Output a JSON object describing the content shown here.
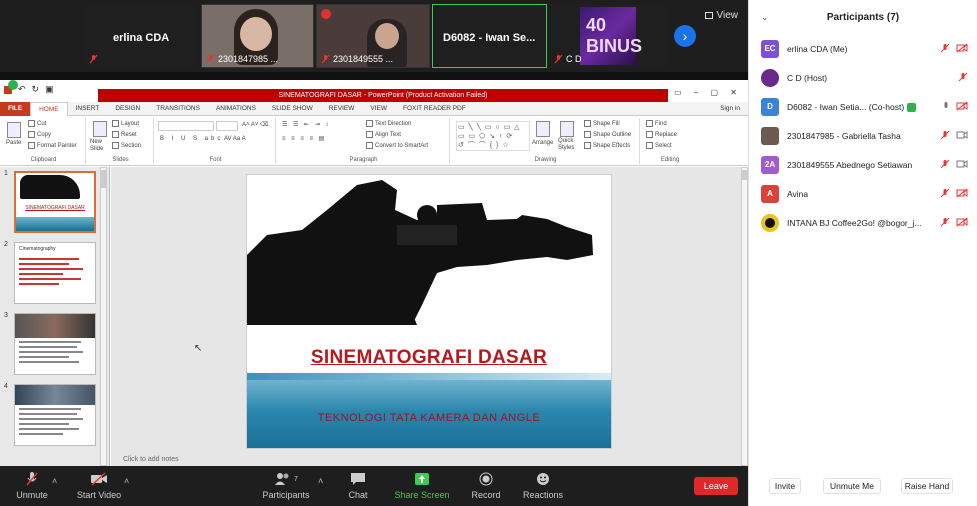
{
  "video_strip": {
    "tiles": [
      {
        "name": "erlina CDA"
      },
      {
        "label": "2301847985 ..."
      },
      {
        "label": "2301849555 ..."
      },
      {
        "name": "D6082 - Iwan Se..."
      },
      {
        "label": "C D"
      }
    ],
    "view_label": "View",
    "logo_text": "40 BINUS"
  },
  "powerpoint": {
    "title_bar": "SINEMATOGRAFI DASAR - PowerPoint (Product Activation Failed)",
    "sign_in": "Sign in",
    "tabs": [
      "FILE",
      "HOME",
      "INSERT",
      "DESIGN",
      "TRANSITIONS",
      "ANIMATIONS",
      "SLIDE SHOW",
      "REVIEW",
      "VIEW",
      "FOXIT READER PDF"
    ],
    "groups": {
      "clipboard": {
        "label": "Clipboard",
        "paste": "Paste",
        "cut": "Cut",
        "copy": "Copy",
        "format_painter": "Format Painter"
      },
      "slides": {
        "label": "Slides",
        "new_slide": "New Slide",
        "layout": "Layout",
        "reset": "Reset",
        "section": "Section"
      },
      "font": {
        "label": "Font"
      },
      "paragraph": {
        "label": "Paragraph",
        "text_direction": "Text Direction",
        "align_text": "Align Text",
        "convert": "Convert to SmartArt"
      },
      "drawing": {
        "label": "Drawing",
        "arrange": "Arrange",
        "quick_styles": "Quick Styles",
        "shape_fill": "Shape Fill",
        "shape_outline": "Shape Outline",
        "shape_effects": "Shape Effects"
      },
      "editing": {
        "label": "Editing",
        "find": "Find",
        "replace": "Replace",
        "select": "Select"
      }
    },
    "slide_numbers": [
      "1",
      "2",
      "3",
      "4"
    ],
    "thumb2_title": "Cinematography",
    "thumb1_title": "SINEMATOGRAFI DASAR",
    "slide": {
      "title": "SINEMATOGRAFI DASAR",
      "subtitle": "TEKNOLOGI TATA KAMERA DAN ANGLE"
    },
    "notes_placeholder": "Click to add notes"
  },
  "toolbar": {
    "unmute": "Unmute",
    "start_video": "Start Video",
    "participants": "Participants",
    "participants_count": "7",
    "chat": "Chat",
    "share_screen": "Share Screen",
    "record": "Record",
    "reactions": "Reactions",
    "leave": "Leave"
  },
  "panel": {
    "title": "Participants (7)",
    "participants": [
      {
        "initials": "EC",
        "name": "erlina CDA (Me)",
        "color": "#7b52d6"
      },
      {
        "initials": "",
        "name": "C D (Host)",
        "color": "#6a2a8c"
      },
      {
        "initials": "D",
        "name": "D6082 - Iwan Setia... (Co-host)",
        "color": "#3a84d8"
      },
      {
        "initials": "",
        "name": "2301847985 - Gabriella Tasha",
        "color": "#6d5a4f"
      },
      {
        "initials": "2A",
        "name": "2301849555 Abednego Setiawan",
        "color": "#a25bd1"
      },
      {
        "initials": "A",
        "name": "Avina",
        "color": "#d9433a"
      },
      {
        "initials": "",
        "name": "INTANA BJ Coffee2Go! @bogor_j...",
        "color": "#e6c51c"
      }
    ],
    "buttons": {
      "invite": "Invite",
      "unmute_me": "Unmute Me",
      "raise_hand": "Raise Hand"
    }
  },
  "colors": {
    "accent_red": "#c00000",
    "zoom_green": "#3fca50",
    "leave_red": "#e02828",
    "ppt_orange": "#c43b1d"
  }
}
